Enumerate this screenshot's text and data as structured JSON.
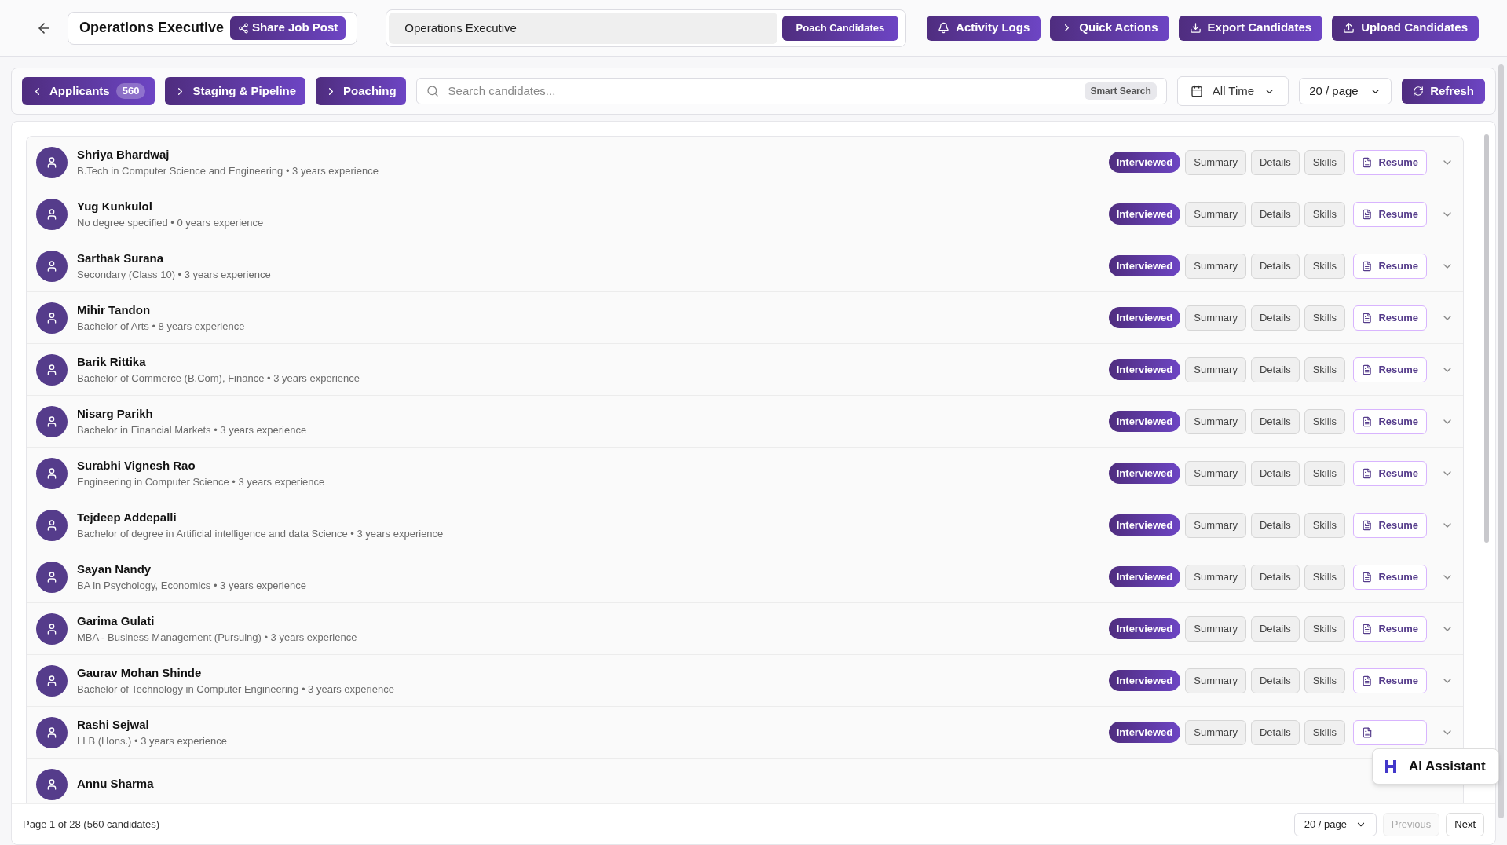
{
  "header": {
    "job_title": "Operations Executive",
    "share_button": "Share Job Post",
    "poach_field_value": "Operations Executive",
    "poach_button": "Poach Candidates",
    "actions": [
      {
        "kind": "bell",
        "label": "Activity Logs"
      },
      {
        "kind": "chevron",
        "label": "Quick Actions"
      },
      {
        "kind": "download",
        "label": "Export Candidates"
      },
      {
        "kind": "upload",
        "label": "Upload Candidates"
      }
    ]
  },
  "toolbar": {
    "views": [
      {
        "kind": "back",
        "label": "Applicants",
        "count": "560"
      },
      {
        "kind": "forward",
        "label": "Staging & Pipeline"
      },
      {
        "kind": "forward",
        "label": "Poaching"
      }
    ],
    "search": {
      "placeholder": "Search candidates...",
      "tag": "Smart Search"
    },
    "date_filter": "All Time",
    "page_size": "20 / page",
    "refresh": "Refresh"
  },
  "candidates": [
    {
      "name": "Shriya Bhardwaj",
      "subtitle": "B.Tech in Computer Science and Engineering • 3 years experience",
      "status": "Interviewed",
      "actions": [
        "Summary",
        "Details",
        "Skills"
      ],
      "resume": "Resume"
    },
    {
      "name": "Yug Kunkulol",
      "subtitle": "No degree specified • 0 years experience",
      "status": "Interviewed",
      "actions": [
        "Summary",
        "Details",
        "Skills"
      ],
      "resume": "Resume"
    },
    {
      "name": "Sarthak Surana",
      "subtitle": "Secondary (Class 10) • 3 years experience",
      "status": "Interviewed",
      "actions": [
        "Summary",
        "Details",
        "Skills"
      ],
      "resume": "Resume"
    },
    {
      "name": "Mihir Tandon",
      "subtitle": "Bachelor of Arts • 8 years experience",
      "status": "Interviewed",
      "actions": [
        "Summary",
        "Details",
        "Skills"
      ],
      "resume": "Resume"
    },
    {
      "name": "Barik Rittika",
      "subtitle": "Bachelor of Commerce (B.Com), Finance • 3 years experience",
      "status": "Interviewed",
      "actions": [
        "Summary",
        "Details",
        "Skills"
      ],
      "resume": "Resume"
    },
    {
      "name": "Nisarg Parikh",
      "subtitle": "Bachelor in Financial Markets • 3 years experience",
      "status": "Interviewed",
      "actions": [
        "Summary",
        "Details",
        "Skills"
      ],
      "resume": "Resume"
    },
    {
      "name": "Surabhi Vignesh Rao",
      "subtitle": "Engineering in Computer Science • 3 years experience",
      "status": "Interviewed",
      "actions": [
        "Summary",
        "Details",
        "Skills"
      ],
      "resume": "Resume"
    },
    {
      "name": "Tejdeep Addepalli",
      "subtitle": "Bachelor of degree in Artificial intelligence and data Science • 3 years experience",
      "status": "Interviewed",
      "actions": [
        "Summary",
        "Details",
        "Skills"
      ],
      "resume": "Resume"
    },
    {
      "name": "Sayan Nandy",
      "subtitle": "BA in Psychology, Economics • 3 years experience",
      "status": "Interviewed",
      "actions": [
        "Summary",
        "Details",
        "Skills"
      ],
      "resume": "Resume"
    },
    {
      "name": "Garima Gulati",
      "subtitle": "MBA - Business Management (Pursuing) • 3 years experience",
      "status": "Interviewed",
      "actions": [
        "Summary",
        "Details",
        "Skills"
      ],
      "resume": "Resume"
    },
    {
      "name": "Gaurav Mohan Shinde",
      "subtitle": "Bachelor of Technology in Computer Engineering • 3 years experience",
      "status": "Interviewed",
      "actions": [
        "Summary",
        "Details",
        "Skills"
      ],
      "resume": "Resume"
    },
    {
      "name": "Rashi Sejwal",
      "subtitle": "LLB (Hons.) • 3 years experience",
      "status": "Interviewed",
      "actions": [
        "Summary",
        "Details",
        "Skills"
      ]
    },
    {
      "name": "Annu Sharma"
    }
  ],
  "footer": {
    "page_info": "Page 1 of 28 (560 candidates)",
    "page_size": "20 / page",
    "pages": [
      {
        "label": "Previous",
        "disabled": true
      },
      {
        "label": "Next",
        "disabled": false
      }
    ]
  },
  "assistant": {
    "label": "AI Assistant"
  }
}
